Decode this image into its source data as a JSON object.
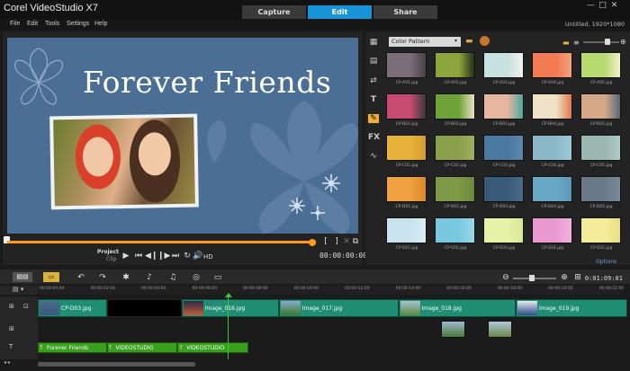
{
  "app": {
    "title": "Corel VideoStudio X7",
    "project_info": "Untitled, 1920*1080"
  },
  "tabs": [
    {
      "label": "Capture"
    },
    {
      "label": "Edit"
    },
    {
      "label": "Share"
    }
  ],
  "menu": [
    "File",
    "Edit",
    "Tools",
    "Settings",
    "Help"
  ],
  "preview": {
    "title_text": "Forever Friends",
    "project_label": "Project",
    "clip_label": "Clip",
    "hd_label": "HD",
    "timecode": "00:00:00:00"
  },
  "library": {
    "category": "Color Pattern",
    "options_label": "Options",
    "thumbs": [
      {
        "label": "CP-A01.jpg",
        "c1": "#7a6f78",
        "c2": "#4a4048"
      },
      {
        "label": "CP-A02.jpg",
        "c1": "#8ca63c",
        "c2": "#243018"
      },
      {
        "label": "CP-A03.jpg",
        "c1": "#c7e2e0",
        "c2": "#f0f0f0"
      },
      {
        "label": "CP-A04.jpg",
        "c1": "#f27b52",
        "c2": "#f5a080"
      },
      {
        "label": "CP-A05.jpg",
        "c1": "#b8d870",
        "c2": "#f2f2c8"
      },
      {
        "label": "CP-B01.jpg",
        "c1": "#c74a72",
        "c2": "#3a3a3a"
      },
      {
        "label": "CP-B02.jpg",
        "c1": "#6fa23a",
        "c2": "#e9e0c0"
      },
      {
        "label": "CP-B03.jpg",
        "c1": "#e6b6a0",
        "c2": "#4aa89e"
      },
      {
        "label": "CP-B04.jpg",
        "c1": "#f0e2c8",
        "c2": "#e07a4a"
      },
      {
        "label": "CP-B05.jpg",
        "c1": "#d6a888",
        "c2": "#5a6a78"
      },
      {
        "label": "CP-C01.jpg",
        "c1": "#e6b23a",
        "c2": "#d89a2a"
      },
      {
        "label": "CP-C02.jpg",
        "c1": "#8aa04a",
        "c2": "#a0b060"
      },
      {
        "label": "CP-C03.jpg",
        "c1": "#4a78a0",
        "c2": "#5a88b0"
      },
      {
        "label": "CP-C04.jpg",
        "c1": "#8ab8c8",
        "c2": "#a0c8d6"
      },
      {
        "label": "CP-C05.jpg",
        "c1": "#9ab8b0",
        "c2": "#b0ccc4"
      },
      {
        "label": "CP-D01.jpg",
        "c1": "#f0a040",
        "c2": "#e08a28"
      },
      {
        "label": "CP-D02.jpg",
        "c1": "#7e9a48",
        "c2": "#6a8838"
      },
      {
        "label": "CP-D03.jpg",
        "c1": "#3a5a7a",
        "c2": "#4a6c8c"
      },
      {
        "label": "CP-D04.jpg",
        "c1": "#6aa8c8",
        "c2": "#5a98b8"
      },
      {
        "label": "CP-D05.jpg",
        "c1": "#6a7a88",
        "c2": "#7a8a98"
      },
      {
        "label": "CP-E01.jpg",
        "c1": "#c8e2ee",
        "c2": "#dceef4"
      },
      {
        "label": "CP-E02.jpg",
        "c1": "#7ac8e0",
        "c2": "#98d8ea"
      },
      {
        "label": "CP-E03.jpg",
        "c1": "#e6f2a8",
        "c2": "#d8e890"
      },
      {
        "label": "CP-E04.jpg",
        "c1": "#e89ad0",
        "c2": "#f2b0dc"
      },
      {
        "label": "CP-E05.jpg",
        "c1": "#f4ec98",
        "c2": "#eae080"
      }
    ]
  },
  "timeline": {
    "timecode": "0:01:09:01",
    "ruler": [
      "00:00:00:00",
      "00:00:02:00",
      "00:00:04:00",
      "00:00:06:00",
      "00:00:08:00",
      "00:00:10:00",
      "00:00:12:00",
      "00:00:14:00",
      "00:00:16:00",
      "00:00:18:00",
      "00:00:20:00",
      "00:00:22:00"
    ],
    "video_clips": [
      {
        "label": "CP-D03.jpg",
        "c1": "#3a5a7a",
        "c2": "#4a6c8c",
        "start": 0,
        "length": 1.7
      },
      {
        "label": "",
        "c1": "#000000",
        "c2": "#000000",
        "start": 1.7,
        "length": 1.85
      },
      {
        "label": "Image_016.jpg",
        "c1": "#c55a3a",
        "c2": "#2a2a44",
        "start": 3.55,
        "length": 2.4
      },
      {
        "label": "Image_017.jpg",
        "c1": "#3a7a2a",
        "c2": "#8aa8d0",
        "start": 5.95,
        "length": 2.95
      },
      {
        "label": "Image_018.jpg",
        "c1": "#5a8a3a",
        "c2": "#a8c0d8",
        "start": 8.9,
        "length": 2.9
      },
      {
        "label": "Image_019.jpg",
        "c1": "#2a4a8a",
        "c2": "#e8e8f0",
        "start": 11.8,
        "length": 2.75
      }
    ],
    "overlay_clips": [
      {
        "c1": "#4a7a3a",
        "c2": "#9ab8d0",
        "start": 9.95,
        "length": 0.6
      },
      {
        "c1": "#6a8a4a",
        "c2": "#b0c8d8",
        "start": 11.1,
        "length": 0.6
      }
    ],
    "title_clips": [
      {
        "label": "Forever Friends",
        "start": 0,
        "length": 1.7
      },
      {
        "label": "VIDEOSTUDIO",
        "start": 1.7,
        "length": 1.75
      },
      {
        "label": "VIDEOSTUDIO",
        "start": 3.45,
        "length": 1.75
      }
    ]
  }
}
